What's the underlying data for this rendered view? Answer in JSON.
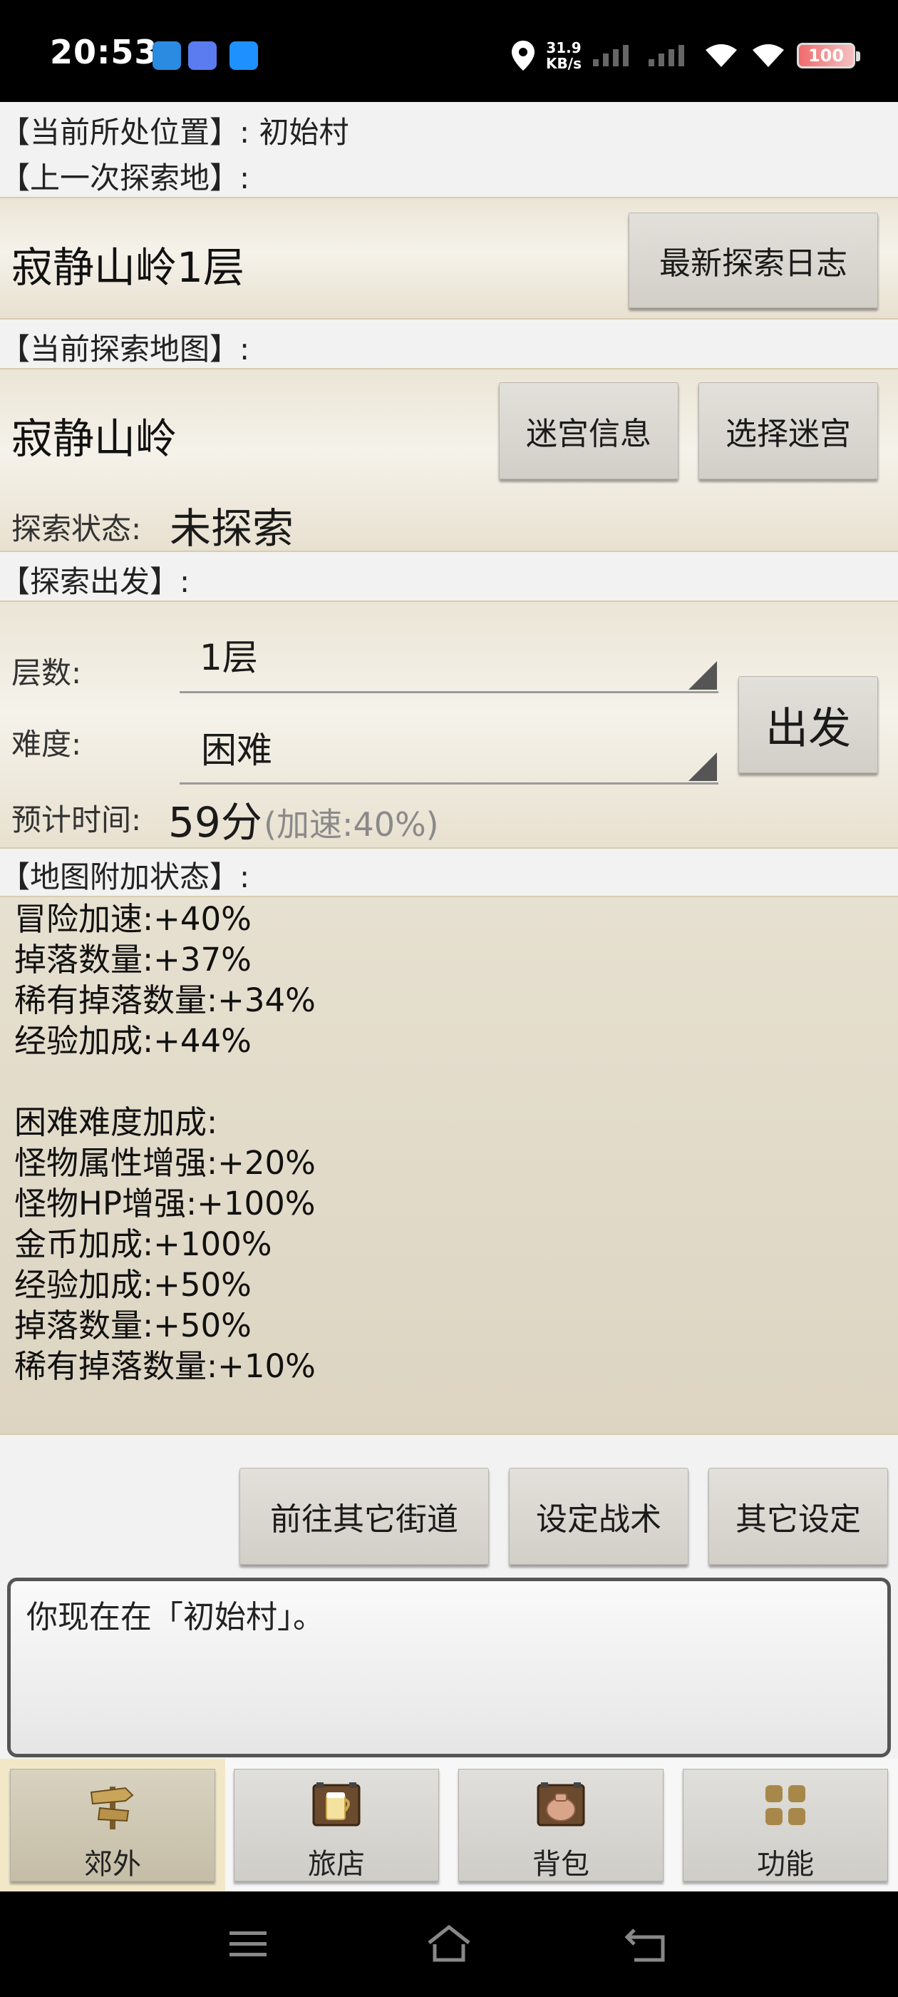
{
  "status_bar": {
    "time": "20:53",
    "speed_value": "31.9",
    "speed_unit": "KB/s",
    "battery": "100"
  },
  "location": {
    "label": "【当前所处位置】: 初始村"
  },
  "last_explored": {
    "heading": "【上一次探索地】:",
    "name": "寂静山岭1层",
    "log_button": "最新探索日志"
  },
  "current_map": {
    "heading": "【当前探索地图】:",
    "name": "寂静山岭",
    "info_button": "迷宫信息",
    "select_button": "选择迷宫",
    "status_label": "探索状态:",
    "status_value": "未探索"
  },
  "departure": {
    "heading": "【探索出发】:",
    "floor_label": "层数:",
    "floor_value": "1层",
    "difficulty_label": "难度:",
    "difficulty_value": "困难",
    "go_button": "出发",
    "eta_label": "预计时间:",
    "eta_value": "59分",
    "eta_note": "(加速:40%)"
  },
  "map_effects": {
    "heading": "【地图附加状态】:",
    "text": "冒险加速:+40%\n掉落数量:+37%\n稀有掉落数量:+34%\n经验加成:+44%\n\n困难难度加成:\n怪物属性增强:+20%\n怪物HP增强:+100%\n金币加成:+100%\n经验加成:+50%\n掉落数量:+50%\n稀有掉落数量:+10%"
  },
  "actions": {
    "other_streets": "前往其它街道",
    "tactics": "设定战术",
    "other_settings": "其它设定"
  },
  "message": "你现在在「初始村」。",
  "tabs": [
    {
      "label": "郊外",
      "icon": "signpost-icon",
      "active": true
    },
    {
      "label": "旅店",
      "icon": "tavern-icon",
      "active": false
    },
    {
      "label": "背包",
      "icon": "bag-icon",
      "active": false
    },
    {
      "label": "功能",
      "icon": "grid-icon",
      "active": false
    }
  ]
}
